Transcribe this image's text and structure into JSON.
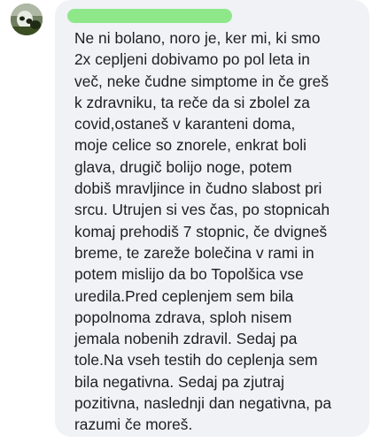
{
  "comment": {
    "author_redaction_color": "#8ee88a",
    "bubble_color": "#f0f2f5",
    "text_color": "#1c1e21",
    "avatar_icon": "profile-photo",
    "text": "Ne ni bolano, noro je, ker mi, ki smo\n2x cepljeni dobivamo po pol leta in\nveč, neke čudne simptome in če greš\nk zdravniku, ta reče da si zbolel za\ncovid,ostaneš v karanteni doma,\nmoje celice so znorele, enkrat boli\nglava, drugič bolijo noge, potem\ndobiš mravljince in čudno slabost pri\nsrcu. Utrujen si ves čas, po stopnicah\nkomaj prehodiš 7 stopnic, če dvigneš\nbreme, te zareže bolečina v rami in\npotem mislijo da bo Topolšica vse\nuredila.Pred ceplenjem sem bila\npopolnoma zdrava, sploh nisem\njemala nobenih zdravil. Sedaj pa\ntole.Na vseh testih do ceplenja sem\nbila negativna. Sedaj pa zjutraj\npozitivna, naslednji dan negativna, pa\nrazumi če moreš."
  }
}
